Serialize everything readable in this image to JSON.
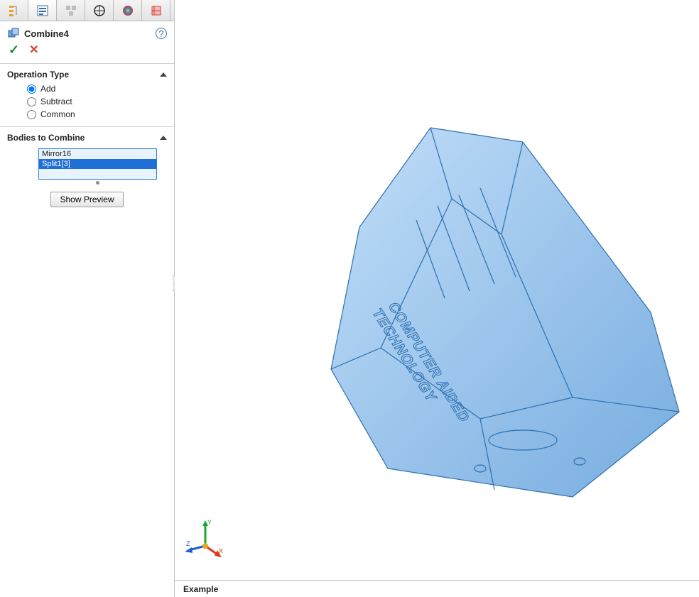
{
  "feature": {
    "title": "Combine4"
  },
  "operation_type": {
    "label": "Operation Type",
    "options": {
      "add": "Add",
      "subtract": "Subtract",
      "common": "Common"
    },
    "selected": "add"
  },
  "bodies": {
    "label": "Bodies to Combine",
    "items": [
      "Mirror16",
      "Split1[3]"
    ],
    "selected_index": 1
  },
  "buttons": {
    "show_preview": "Show Preview"
  },
  "status": {
    "text": "Example"
  },
  "triad": {
    "axes": {
      "x": "X",
      "y": "Y",
      "z": "Z"
    }
  },
  "model": {
    "label_text": [
      "COMPUTER AIDED",
      "TECHNOLOGY"
    ]
  },
  "colors": {
    "selection_blue": "#1e6fd6",
    "wire_blue": "#3a82d6",
    "fill_blue": "#8cbef2"
  }
}
